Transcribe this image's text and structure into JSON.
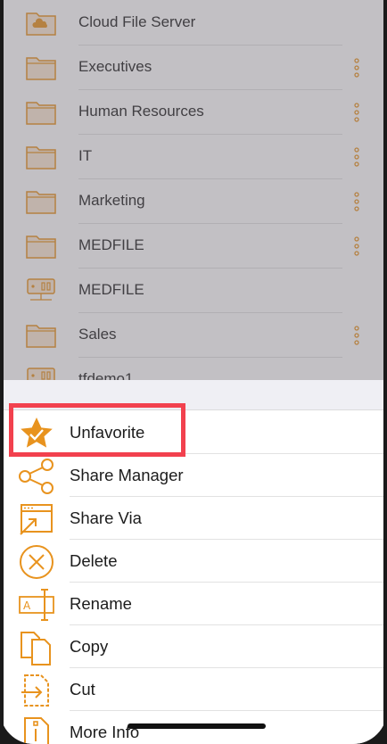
{
  "file_list": {
    "items": [
      {
        "name": "Cloud File Server",
        "icon": "cloud-folder-icon",
        "has_more": false
      },
      {
        "name": "Executives",
        "icon": "folder-icon",
        "has_more": true
      },
      {
        "name": "Human Resources",
        "icon": "folder-icon",
        "has_more": true
      },
      {
        "name": "IT",
        "icon": "folder-icon",
        "has_more": true
      },
      {
        "name": "Marketing",
        "icon": "folder-icon",
        "has_more": true
      },
      {
        "name": "MEDFILE",
        "icon": "folder-icon",
        "has_more": true
      },
      {
        "name": "MEDFILE",
        "icon": "server-icon",
        "has_more": false
      },
      {
        "name": "Sales",
        "icon": "folder-icon",
        "has_more": true
      },
      {
        "name": "tfdemo1",
        "icon": "server-icon",
        "has_more": false
      }
    ]
  },
  "action_sheet": {
    "actions": [
      {
        "label": "Unfavorite",
        "icon": "star-icon"
      },
      {
        "label": "Share Manager",
        "icon": "share-icon"
      },
      {
        "label": "Share Via",
        "icon": "share-via-icon"
      },
      {
        "label": "Delete",
        "icon": "delete-icon"
      },
      {
        "label": "Rename",
        "icon": "rename-icon"
      },
      {
        "label": "Copy",
        "icon": "copy-icon"
      },
      {
        "label": "Cut",
        "icon": "cut-icon"
      },
      {
        "label": "More Info",
        "icon": "info-icon"
      }
    ]
  },
  "colors": {
    "accent": "#e8931e",
    "highlight": "#f2414e"
  }
}
